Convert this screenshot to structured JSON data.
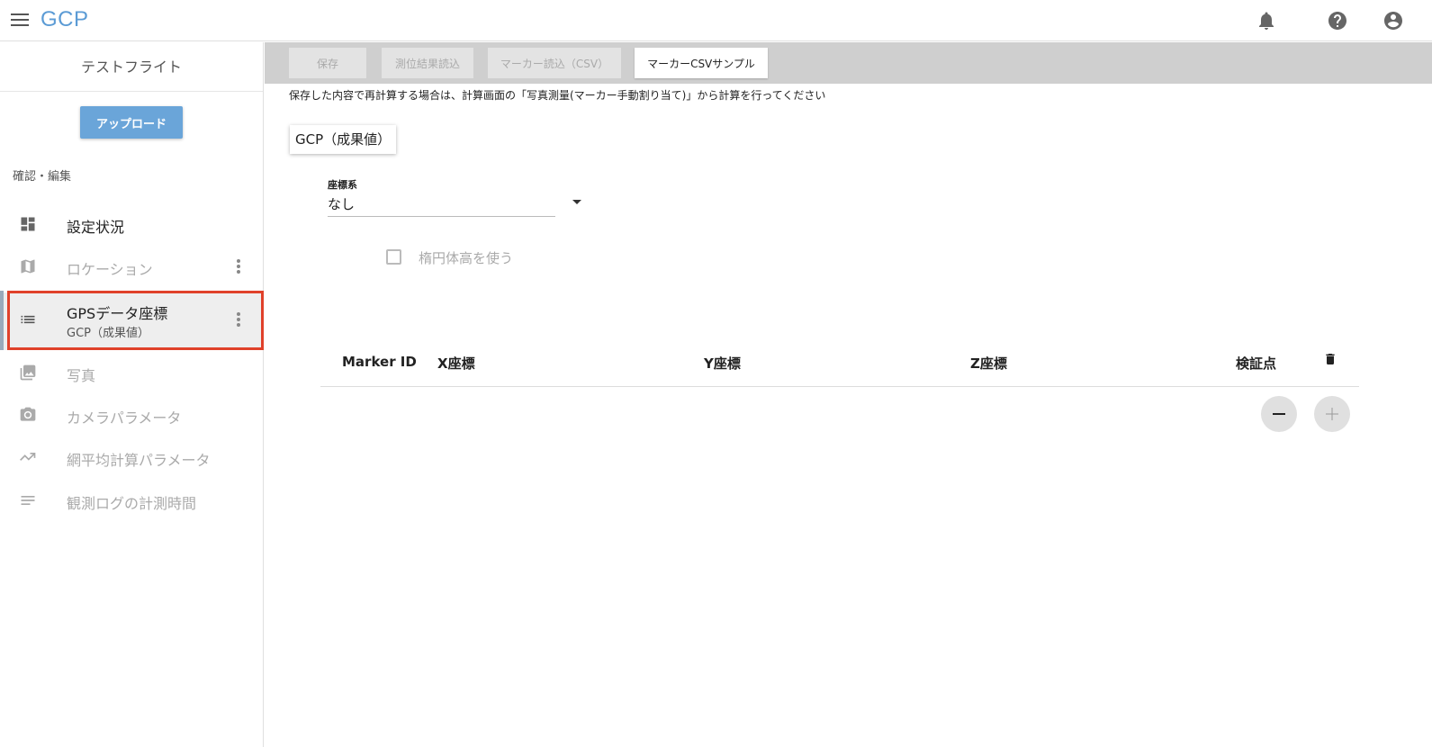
{
  "app": {
    "title": "GCP"
  },
  "header_icons": [
    "notifications-icon",
    "help-icon",
    "account-icon"
  ],
  "sidebar": {
    "header": "テストフライト",
    "upload_label": "アップロード",
    "section_label": "確認・編集",
    "items": [
      {
        "label": "設定状況",
        "icon": "dashboard-icon",
        "disabled": false
      },
      {
        "label": "ロケーション",
        "icon": "map-icon",
        "disabled": true
      },
      {
        "label": "GPSデータ座標",
        "sub": "GCP（成果値）",
        "icon": "list-icon",
        "selected": true
      },
      {
        "label": "写真",
        "icon": "photo-library-icon",
        "disabled": true
      },
      {
        "label": "カメラパラメータ",
        "icon": "camera-icon",
        "disabled": true
      },
      {
        "label": "網平均計算パラメータ",
        "icon": "trending-icon",
        "disabled": true
      },
      {
        "label": "観測ログの計測時間",
        "icon": "notes-icon",
        "disabled": true
      }
    ]
  },
  "toolbar": {
    "save": "保存",
    "load_results": "測位結果読込",
    "load_markers": "マーカー読込（CSV）",
    "csv_sample": "マーカーCSVサンプル"
  },
  "notice": "保存した内容で再計算する場合は、計算画面の「写真測量(マーカー手動割り当て)」から計算を行ってください",
  "section_chip": "GCP（成果値）",
  "coord_system": {
    "label": "座標系",
    "value": "なし"
  },
  "ellipsoid_checkbox": {
    "label": "楕円体高を使う",
    "checked": false
  },
  "table": {
    "columns": [
      "Marker ID",
      "X座標",
      "Y座標",
      "Z座標",
      "検証点"
    ],
    "rows": []
  },
  "colors": {
    "accent": "#5b9bd5",
    "upload_button": "#6aa5d9",
    "highlight": "#e0412a"
  }
}
